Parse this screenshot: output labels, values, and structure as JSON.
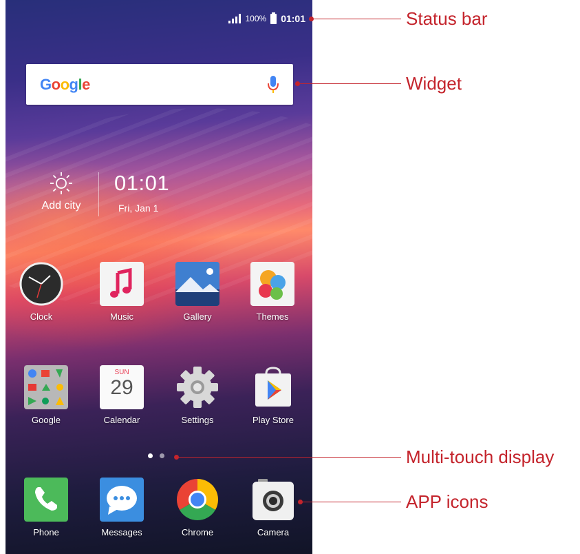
{
  "status_bar": {
    "battery_percent": "100%",
    "time": "01:01"
  },
  "search_widget": {
    "logo_text": "Google",
    "mic_icon": "microphone-icon"
  },
  "weather_widget": {
    "icon": "sun-icon",
    "city_label": "Add city"
  },
  "clock_widget": {
    "time": "01:01",
    "date": "Fri, Jan 1"
  },
  "apps_row1": [
    {
      "label": "Clock",
      "icon": "clock-icon"
    },
    {
      "label": "Music",
      "icon": "music-note-icon"
    },
    {
      "label": "Gallery",
      "icon": "gallery-icon"
    },
    {
      "label": "Themes",
      "icon": "balloons-icon"
    }
  ],
  "apps_row2": [
    {
      "label": "Google",
      "icon": "folder-icon"
    },
    {
      "label": "Calendar",
      "icon": "calendar-icon",
      "day_name": "SUN",
      "day_number": "29"
    },
    {
      "label": "Settings",
      "icon": "gear-icon"
    },
    {
      "label": "Play Store",
      "icon": "play-store-icon"
    }
  ],
  "page_indicator": {
    "pages": 2,
    "active": 1
  },
  "dock": [
    {
      "label": "Phone",
      "icon": "phone-icon"
    },
    {
      "label": "Messages",
      "icon": "chat-bubble-icon"
    },
    {
      "label": "Chrome",
      "icon": "chrome-icon"
    },
    {
      "label": "Camera",
      "icon": "camera-icon"
    }
  ],
  "callouts": {
    "status_bar": "Status bar",
    "widget": "Widget",
    "multi_touch": "Multi-touch display",
    "app_icons": "APP icons"
  },
  "colors": {
    "callout": "#c4242c",
    "google_blue": "#4285f4",
    "google_red": "#ea4335",
    "google_yellow": "#fbbc05",
    "google_green": "#34a853"
  }
}
